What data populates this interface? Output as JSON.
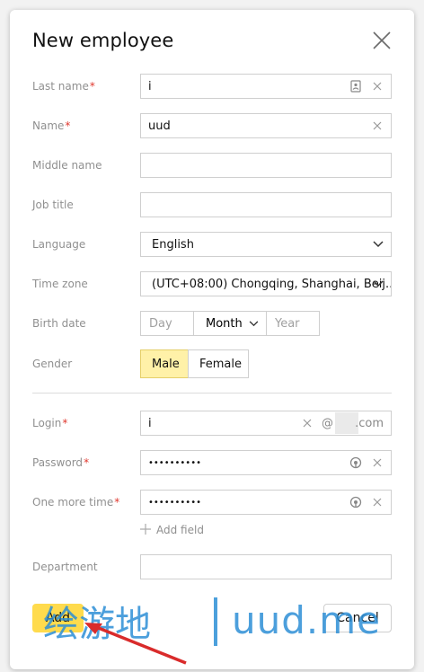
{
  "dialog": {
    "title": "New employee"
  },
  "fields": {
    "last_name": {
      "label": "Last name",
      "required": "*",
      "value": "i"
    },
    "name": {
      "label": "Name",
      "required": "*",
      "value": "uud"
    },
    "middle_name": {
      "label": "Middle name",
      "value": ""
    },
    "job_title": {
      "label": "Job title",
      "value": ""
    },
    "language": {
      "label": "Language",
      "value": "English"
    },
    "time_zone": {
      "label": "Time zone",
      "value": "(UTC+08:00) Chongqing, Shanghai, Beij..."
    },
    "birth_date": {
      "label": "Birth date",
      "day_placeholder": "Day",
      "month": "Month",
      "year_placeholder": "Year"
    },
    "gender": {
      "label": "Gender",
      "options": [
        "Male",
        "Female"
      ],
      "selected": "Male"
    },
    "login": {
      "label": "Login",
      "required": "*",
      "value": "i",
      "at": "@",
      "domain_suffix": ".com"
    },
    "password": {
      "label": "Password",
      "required": "*",
      "value": "••••••••••"
    },
    "password_repeat": {
      "label": "One more time",
      "required": "*",
      "value": "••••••••••"
    },
    "add_field": {
      "label": "Add field"
    },
    "department": {
      "label": "Department",
      "value": ""
    }
  },
  "actions": {
    "add_label": "Add",
    "cancel_label": "Cancel"
  },
  "watermark": {
    "cjk": "绘游地",
    "text": "uud.me"
  },
  "colors": {
    "accent_yellow": "#ffdb4d",
    "selected_segment": "#fff1a8",
    "required_red": "#e0382e",
    "watermark_blue": "#2d8fd6"
  }
}
